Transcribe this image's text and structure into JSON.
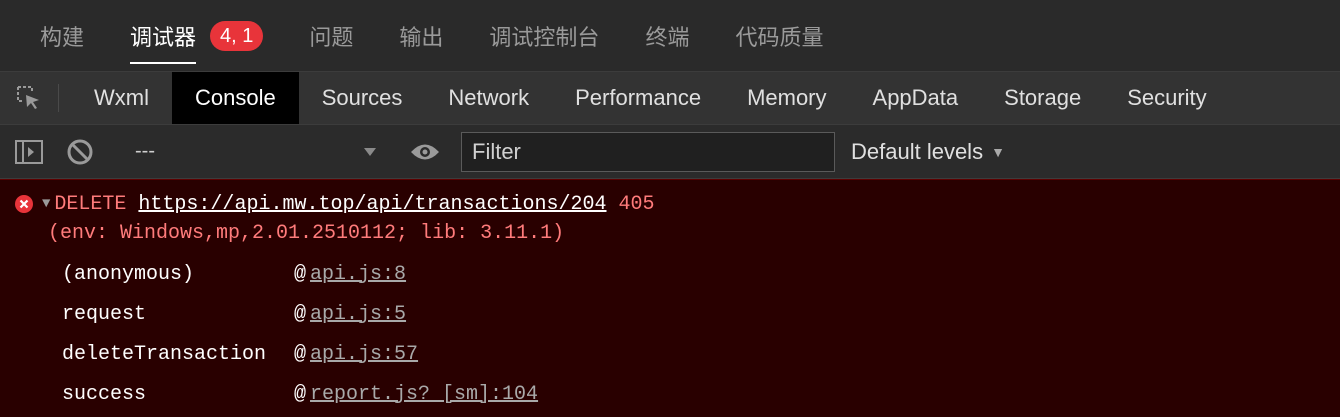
{
  "top_tabs": [
    {
      "label": "构建"
    },
    {
      "label": "调试器",
      "badge": "4, 1"
    },
    {
      "label": "问题"
    },
    {
      "label": "输出"
    },
    {
      "label": "调试控制台"
    },
    {
      "label": "终端"
    },
    {
      "label": "代码质量"
    }
  ],
  "tool_tabs": [
    "Wxml",
    "Console",
    "Sources",
    "Network",
    "Performance",
    "Memory",
    "AppData",
    "Storage",
    "Security"
  ],
  "toolbar": {
    "context": "---",
    "filter_placeholder": "Filter",
    "levels": "Default levels"
  },
  "console": {
    "error": {
      "method": "DELETE",
      "url": "https://api.mw.top/api/transactions/204",
      "status": "405",
      "env": "(env: Windows,mp,2.01.2510112; lib: 3.11.1)"
    },
    "stack": [
      {
        "fn": "(anonymous)",
        "at": "@",
        "loc": "api.js:8"
      },
      {
        "fn": "request",
        "at": "@",
        "loc": "api.js:5"
      },
      {
        "fn": "deleteTransaction",
        "at": "@",
        "loc": "api.js:57"
      },
      {
        "fn": "success",
        "at": "@",
        "loc": "report.js? [sm]:104"
      }
    ]
  },
  "colors": {
    "error_bg": "#290000",
    "error_text": "#ff7b7b",
    "badge": "#e8343a"
  }
}
